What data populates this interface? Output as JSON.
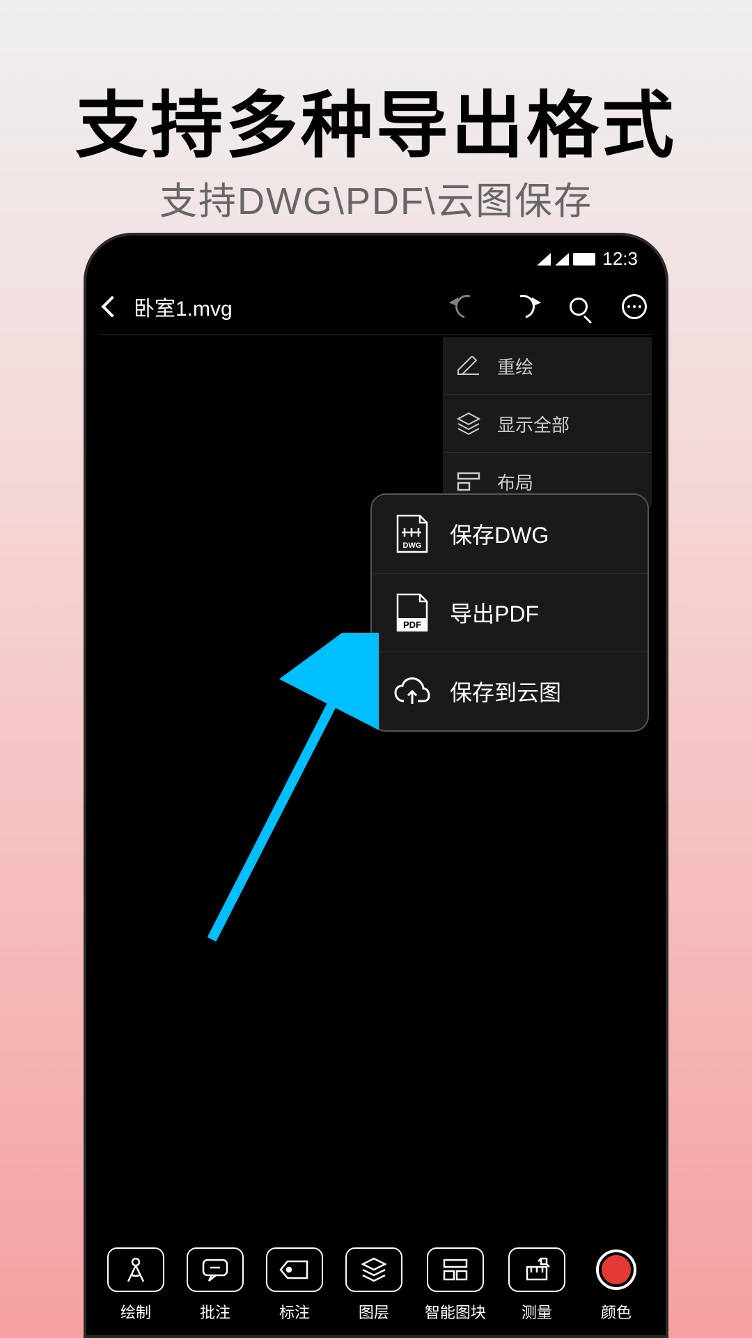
{
  "headline": "支持多种导出格式",
  "subheadline": "支持DWG\\PDF\\云图保存",
  "statusBar": {
    "time": "12:3"
  },
  "header": {
    "fileTitle": "卧室1.mvg"
  },
  "dropdown": {
    "items": [
      {
        "label": "重绘"
      },
      {
        "label": "显示全部"
      },
      {
        "label": "布局"
      }
    ]
  },
  "submenu": {
    "items": [
      {
        "label": "保存DWG"
      },
      {
        "label": "导出PDF"
      },
      {
        "label": "保存到云图"
      }
    ]
  },
  "toolbar": {
    "items": [
      {
        "label": "绘制"
      },
      {
        "label": "批注"
      },
      {
        "label": "标注"
      },
      {
        "label": "图层"
      },
      {
        "label": "智能图块"
      },
      {
        "label": "测量"
      },
      {
        "label": "颜色"
      }
    ]
  }
}
